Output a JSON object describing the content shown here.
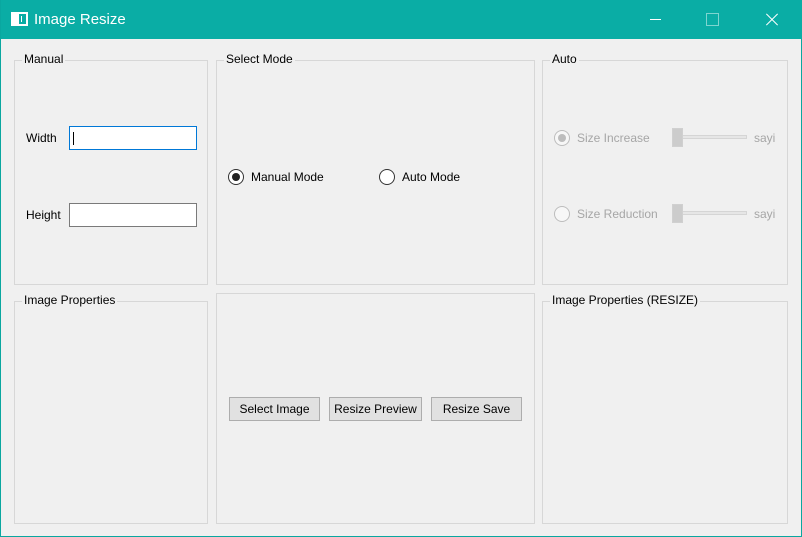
{
  "window": {
    "title": "Image Resize"
  },
  "manual": {
    "legend": "Manual",
    "width_label": "Width",
    "width_value": "",
    "height_label": "Height",
    "height_value": ""
  },
  "select_mode": {
    "legend": "Select Mode",
    "manual_mode": "Manual Mode",
    "auto_mode": "Auto Mode",
    "selected": "Manual Mode"
  },
  "auto": {
    "legend": "Auto",
    "size_increase": "Size Increase",
    "size_reduction": "Size Reduction",
    "slider_suffix": "sayi",
    "size_increase_slider_value": 0,
    "size_reduction_slider_value": 0,
    "selected": "Size Increase"
  },
  "image_properties": {
    "legend": "Image Properties"
  },
  "actions": {
    "select_image": "Select Image",
    "resize_preview": "Resize Preview",
    "resize_save": "Resize Save"
  },
  "image_properties_resize": {
    "legend": "Image Properties (RESIZE)"
  }
}
